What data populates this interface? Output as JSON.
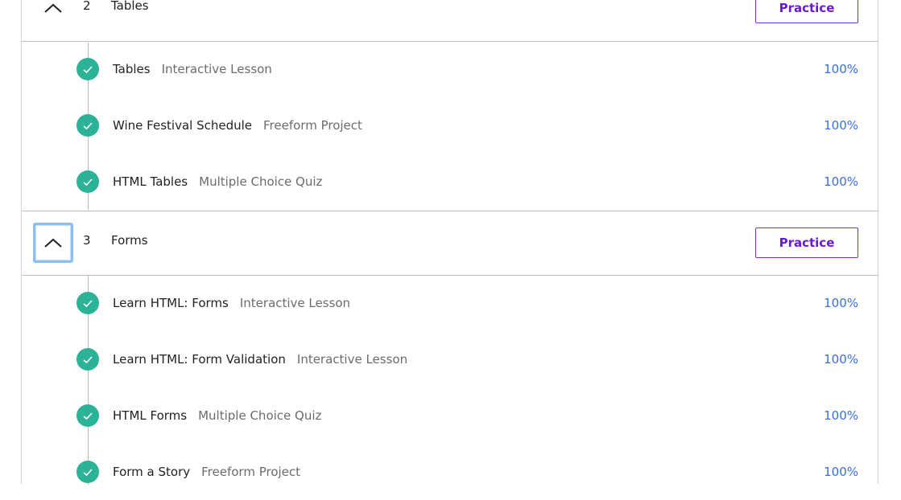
{
  "sections": [
    {
      "number": "2",
      "title": "Tables",
      "practice_label": "Practice",
      "items": [
        {
          "title": "Tables",
          "type": "Interactive Lesson",
          "progress": "100%"
        },
        {
          "title": "Wine Festival Schedule",
          "type": "Freeform Project",
          "progress": "100%"
        },
        {
          "title": "HTML Tables",
          "type": "Multiple Choice Quiz",
          "progress": "100%"
        }
      ]
    },
    {
      "number": "3",
      "title": "Forms",
      "practice_label": "Practice",
      "items": [
        {
          "title": "Learn HTML: Forms",
          "type": "Interactive Lesson",
          "progress": "100%"
        },
        {
          "title": "Learn HTML: Form Validation",
          "type": "Interactive Lesson",
          "progress": "100%"
        },
        {
          "title": "HTML Forms",
          "type": "Multiple Choice Quiz",
          "progress": "100%"
        },
        {
          "title": "Form a Story",
          "type": "Freeform Project",
          "progress": "100%"
        }
      ]
    }
  ],
  "icons": {
    "collapse": "chevron-up-icon",
    "complete": "check-circle-icon"
  },
  "colors": {
    "accent_purple": "#6a1bd1",
    "complete_green": "#2cb297",
    "progress_blue": "#3a6fe0",
    "focus_ring": "#8dbef3"
  }
}
